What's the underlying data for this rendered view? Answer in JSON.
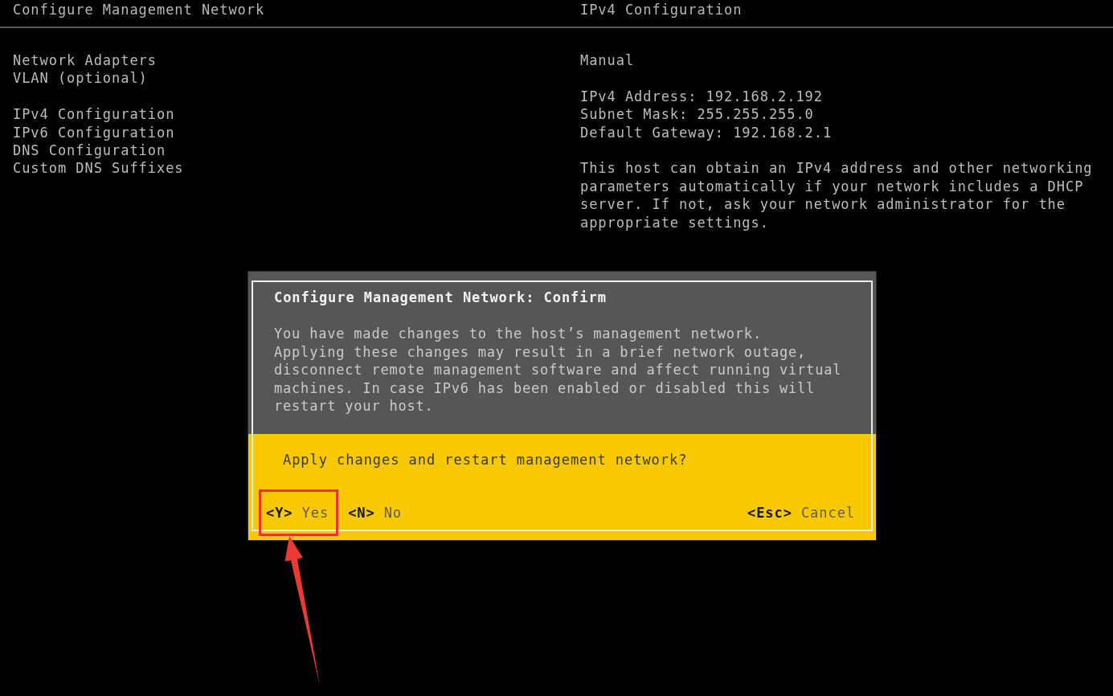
{
  "header": {
    "left_title": "Configure Management Network",
    "right_title": "IPv4 Configuration"
  },
  "menu_groups": [
    {
      "items": [
        {
          "label": "Network Adapters"
        },
        {
          "label": "VLAN (optional)"
        }
      ]
    },
    {
      "items": [
        {
          "label": "IPv4 Configuration"
        },
        {
          "label": "IPv6 Configuration"
        },
        {
          "label": "DNS Configuration"
        },
        {
          "label": "Custom DNS Suffixes"
        }
      ]
    }
  ],
  "details": {
    "mode": "Manual",
    "settings": [
      "IPv4 Address: 192.168.2.192",
      "Subnet Mask: 255.255.255.0",
      "Default Gateway: 192.168.2.1"
    ],
    "description": "This host can obtain an IPv4 address and other networking parameters automatically if your network includes a DHCP server. If not, ask your network administrator for the appropriate settings."
  },
  "dialog": {
    "title": "Configure Management Network: Confirm",
    "message": "You have made changes to the host’s management network.\nApplying these changes may result in a brief network outage, disconnect remote management software and affect running virtual machines. In case IPv6 has been enabled or disabled this will restart your host.",
    "question": "Apply changes and restart management network?",
    "actions": [
      {
        "key": "<Y>",
        "label": "Yes",
        "highlighted": true
      },
      {
        "key": "<N>",
        "label": "No",
        "highlighted": false
      },
      {
        "key": "<Esc>",
        "label": "Cancel",
        "highlighted": false
      }
    ]
  }
}
